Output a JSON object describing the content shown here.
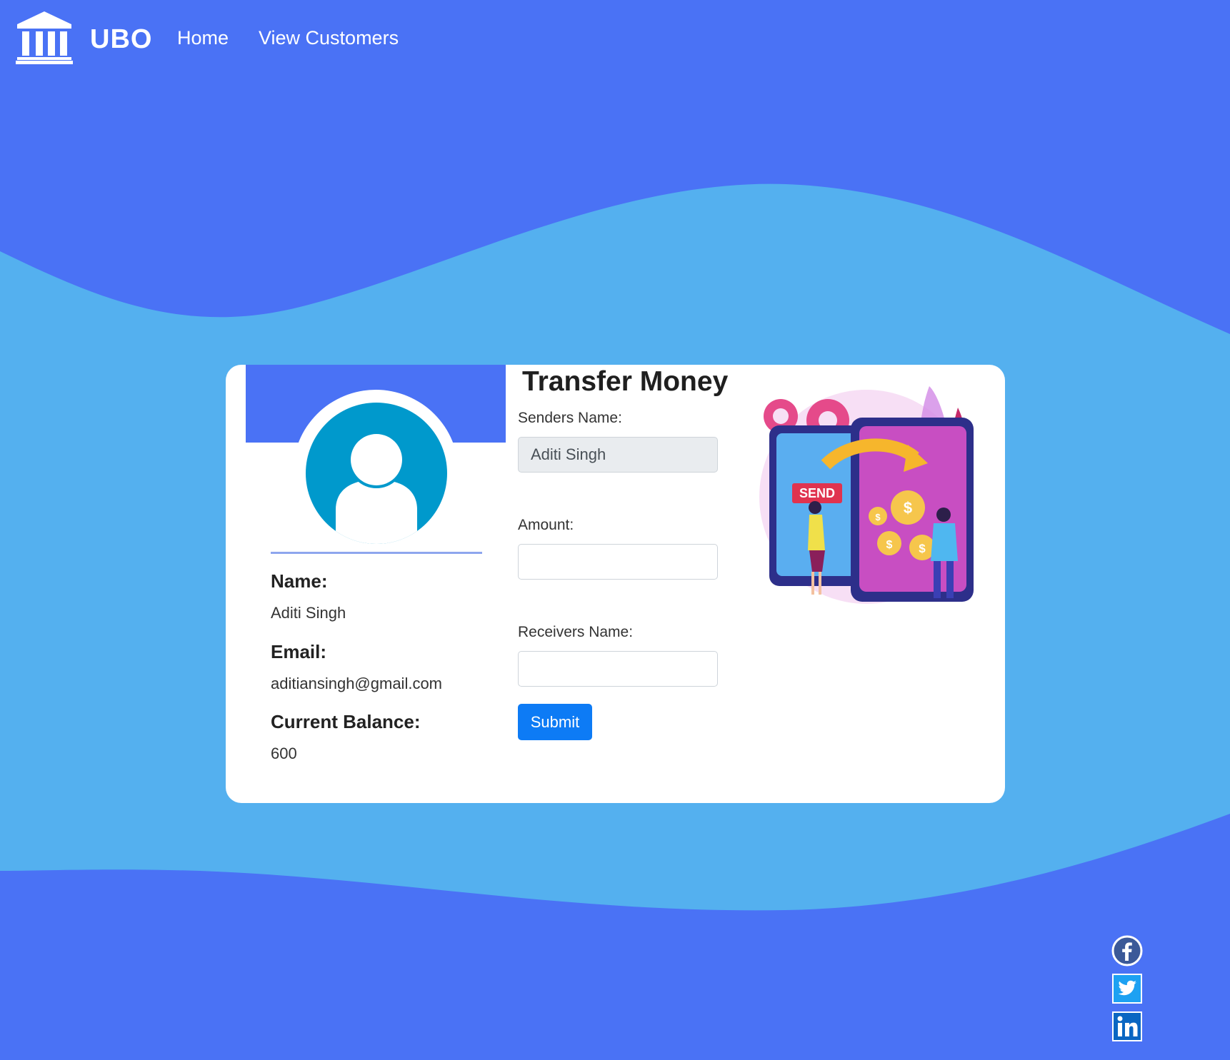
{
  "nav": {
    "brand": "UBO",
    "links": [
      "Home",
      "View Customers"
    ]
  },
  "profile": {
    "name_label": "Name:",
    "name_value": "Aditi Singh",
    "email_label": "Email:",
    "email_value": "aditiansingh@gmail.com",
    "balance_label": "Current Balance:",
    "balance_value": "600"
  },
  "form": {
    "title": "Transfer Money",
    "sender_label": "Senders Name:",
    "sender_value": "Aditi Singh",
    "amount_label": "Amount:",
    "amount_value": "",
    "receiver_label": "Receivers Name:",
    "receiver_value": "",
    "submit_label": "Submit"
  },
  "illustration": {
    "send_text": "SEND"
  },
  "social": [
    "facebook-icon",
    "twitter-icon",
    "linkedin-icon"
  ],
  "colors": {
    "background": "#4a72f5",
    "wave": "#54b0ef",
    "submit": "#0d7bf5",
    "avatar": "#0099cc"
  }
}
